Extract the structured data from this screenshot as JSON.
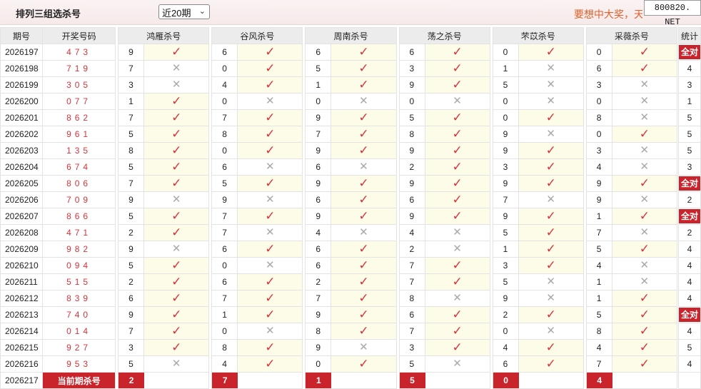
{
  "header": {
    "title": "排列三组选杀号",
    "period_select": "近20期",
    "slogan": "要想中大奖，天",
    "site": "800820. NET"
  },
  "columns": {
    "period": "期号",
    "draw": "开奖号码",
    "stat": "统计",
    "killers": [
      "鸿雁杀号",
      "谷风杀号",
      "周南杀号",
      "荡之杀号",
      "芣苡杀号",
      "采薇杀号"
    ]
  },
  "current": {
    "period": "2026217",
    "label": "当前期杀号",
    "kills": [
      "2",
      "7",
      "1",
      "5",
      "0",
      "4"
    ]
  },
  "rows": [
    {
      "period": "2026197",
      "draw": "473",
      "kills": [
        "9",
        "6",
        "6",
        "6",
        "0",
        "0"
      ],
      "hits": [
        1,
        1,
        1,
        1,
        1,
        1
      ],
      "stat": "全对"
    },
    {
      "period": "2026198",
      "draw": "719",
      "kills": [
        "7",
        "0",
        "5",
        "3",
        "1",
        "6"
      ],
      "hits": [
        0,
        1,
        1,
        1,
        0,
        1
      ],
      "stat": "4"
    },
    {
      "period": "2026199",
      "draw": "305",
      "kills": [
        "3",
        "4",
        "1",
        "9",
        "5",
        "3"
      ],
      "hits": [
        0,
        1,
        1,
        1,
        0,
        0
      ],
      "stat": "3"
    },
    {
      "period": "2026200",
      "draw": "077",
      "kills": [
        "1",
        "0",
        "0",
        "0",
        "0",
        "0"
      ],
      "hits": [
        1,
        0,
        0,
        0,
        0,
        0
      ],
      "stat": "1"
    },
    {
      "period": "2026201",
      "draw": "862",
      "kills": [
        "7",
        "7",
        "9",
        "5",
        "0",
        "8"
      ],
      "hits": [
        1,
        1,
        1,
        1,
        1,
        0
      ],
      "stat": "5"
    },
    {
      "period": "2026202",
      "draw": "961",
      "kills": [
        "5",
        "8",
        "7",
        "8",
        "9",
        "0"
      ],
      "hits": [
        1,
        1,
        1,
        1,
        0,
        1
      ],
      "stat": "5"
    },
    {
      "period": "2026203",
      "draw": "135",
      "kills": [
        "8",
        "0",
        "9",
        "9",
        "9",
        "3"
      ],
      "hits": [
        1,
        1,
        1,
        1,
        1,
        0
      ],
      "stat": "5"
    },
    {
      "period": "2026204",
      "draw": "674",
      "kills": [
        "5",
        "6",
        "6",
        "2",
        "3",
        "4"
      ],
      "hits": [
        1,
        0,
        0,
        1,
        1,
        0
      ],
      "stat": "3"
    },
    {
      "period": "2026205",
      "draw": "806",
      "kills": [
        "7",
        "5",
        "9",
        "9",
        "9",
        "9"
      ],
      "hits": [
        1,
        1,
        1,
        1,
        1,
        1
      ],
      "stat": "全对"
    },
    {
      "period": "2026206",
      "draw": "709",
      "kills": [
        "9",
        "9",
        "6",
        "6",
        "7",
        "9"
      ],
      "hits": [
        0,
        0,
        1,
        1,
        0,
        0
      ],
      "stat": "2"
    },
    {
      "period": "2026207",
      "draw": "866",
      "kills": [
        "5",
        "7",
        "9",
        "9",
        "9",
        "1"
      ],
      "hits": [
        1,
        1,
        1,
        1,
        1,
        1
      ],
      "stat": "全对"
    },
    {
      "period": "2026208",
      "draw": "471",
      "kills": [
        "2",
        "7",
        "4",
        "4",
        "5",
        "7"
      ],
      "hits": [
        1,
        0,
        0,
        0,
        1,
        0
      ],
      "stat": "2"
    },
    {
      "period": "2026209",
      "draw": "982",
      "kills": [
        "9",
        "6",
        "6",
        "2",
        "1",
        "5"
      ],
      "hits": [
        0,
        1,
        1,
        0,
        1,
        1
      ],
      "stat": "4"
    },
    {
      "period": "2026210",
      "draw": "094",
      "kills": [
        "5",
        "0",
        "6",
        "7",
        "3",
        "4"
      ],
      "hits": [
        1,
        0,
        1,
        1,
        1,
        0
      ],
      "stat": "4"
    },
    {
      "period": "2026211",
      "draw": "515",
      "kills": [
        "2",
        "6",
        "2",
        "7",
        "5",
        "1"
      ],
      "hits": [
        1,
        1,
        1,
        1,
        0,
        0
      ],
      "stat": "4"
    },
    {
      "period": "2026212",
      "draw": "839",
      "kills": [
        "6",
        "7",
        "7",
        "8",
        "9",
        "1"
      ],
      "hits": [
        1,
        1,
        1,
        0,
        0,
        1
      ],
      "stat": "4"
    },
    {
      "period": "2026213",
      "draw": "740",
      "kills": [
        "9",
        "1",
        "9",
        "6",
        "2",
        "5"
      ],
      "hits": [
        1,
        1,
        1,
        1,
        1,
        1
      ],
      "stat": "全对"
    },
    {
      "period": "2026214",
      "draw": "014",
      "kills": [
        "7",
        "0",
        "8",
        "7",
        "0",
        "8"
      ],
      "hits": [
        1,
        0,
        1,
        1,
        0,
        1
      ],
      "stat": "4"
    },
    {
      "period": "2026215",
      "draw": "927",
      "kills": [
        "3",
        "8",
        "9",
        "3",
        "4",
        "4"
      ],
      "hits": [
        1,
        1,
        0,
        1,
        1,
        1
      ],
      "stat": "5"
    },
    {
      "period": "2026216",
      "draw": "953",
      "kills": [
        "5",
        "4",
        "0",
        "5",
        "6",
        "7"
      ],
      "hits": [
        0,
        1,
        1,
        0,
        1,
        1
      ],
      "stat": "4"
    }
  ]
}
